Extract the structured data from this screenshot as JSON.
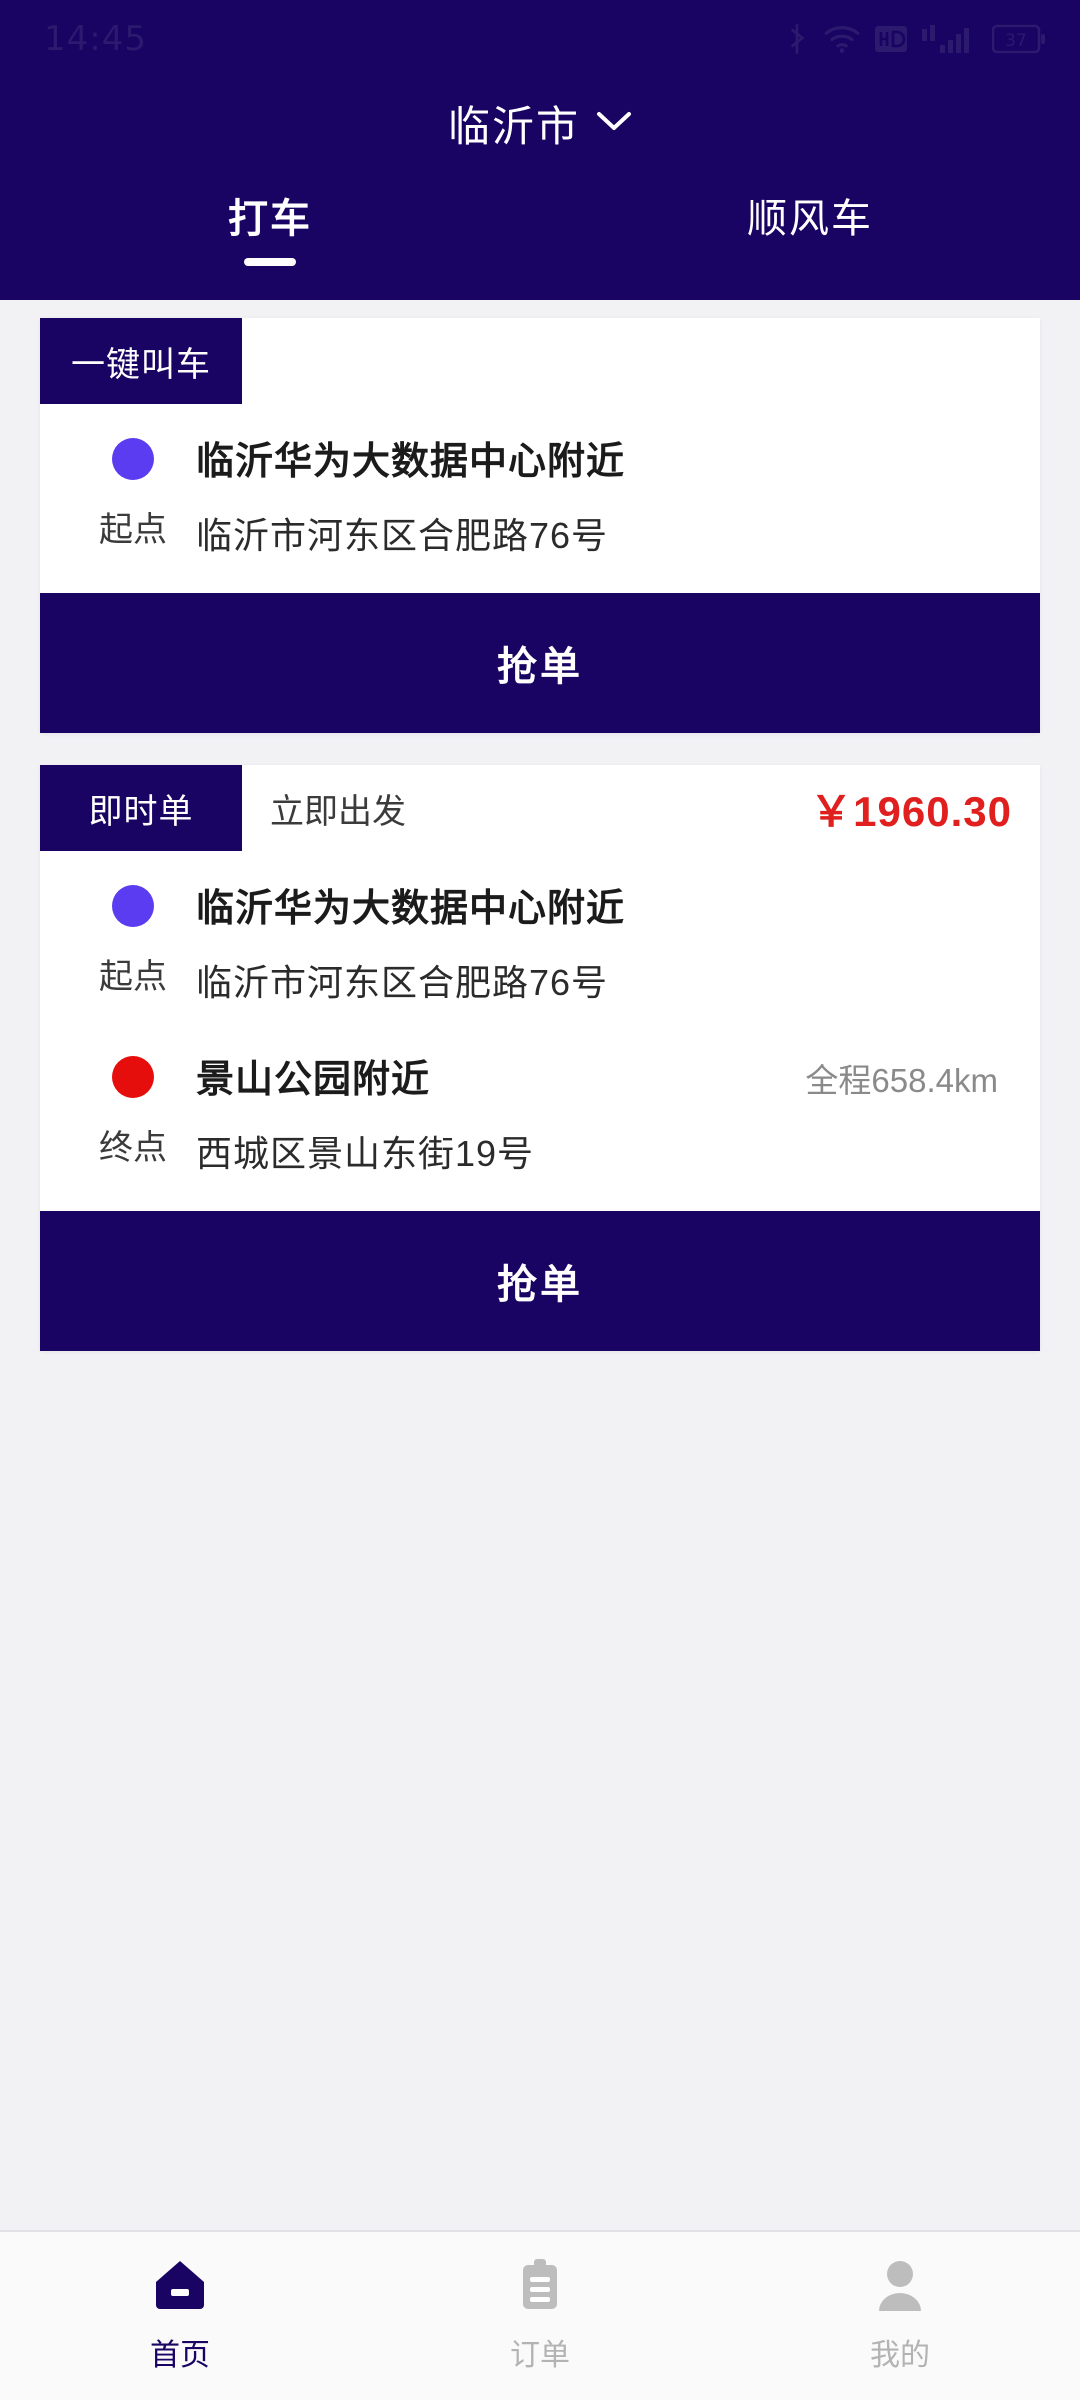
{
  "statusbar": {
    "time": "14:45",
    "icons": [
      "bluetooth-icon",
      "wifi-icon",
      "hd-icon",
      "signal-icon",
      "battery-icon"
    ],
    "battery_level": "37"
  },
  "header": {
    "city": "临沂市",
    "city_chevron": "chevron-down-icon",
    "background_color": "#190363",
    "tabs": [
      {
        "label": "打车",
        "active": true
      },
      {
        "label": "顺风车",
        "active": false
      }
    ]
  },
  "colors": {
    "brand_navy": "#190363",
    "origin_dot": "#5B3CF0",
    "dest_dot": "#E60D0D",
    "price_red": "#E01F1F",
    "page_bg": "#F2F2F5"
  },
  "cards": [
    {
      "badge": "一键叫车",
      "depart_text": "",
      "price": "",
      "legs": [
        {
          "type_label": "起点",
          "marker": "origin-dot-icon",
          "title": "临沂华为大数据中心附近",
          "address": "临沂市河东区合肥路76号",
          "distance": ""
        }
      ],
      "button_label": "抢单"
    },
    {
      "badge": "即时单",
      "depart_text": "立即出发",
      "price": "￥1960.30",
      "legs": [
        {
          "type_label": "起点",
          "marker": "origin-dot-icon",
          "title": "临沂华为大数据中心附近",
          "address": "临沂市河东区合肥路76号",
          "distance": ""
        },
        {
          "type_label": "终点",
          "marker": "destination-dot-icon",
          "title": "景山公园附近",
          "address": "西城区景山东街19号",
          "distance": "全程658.4km"
        }
      ],
      "button_label": "抢单"
    }
  ],
  "bottomnav": [
    {
      "label": "首页",
      "icon": "home-icon",
      "active": true
    },
    {
      "label": "订单",
      "icon": "clipboard-icon",
      "active": false
    },
    {
      "label": "我的",
      "icon": "person-icon",
      "active": false
    }
  ]
}
